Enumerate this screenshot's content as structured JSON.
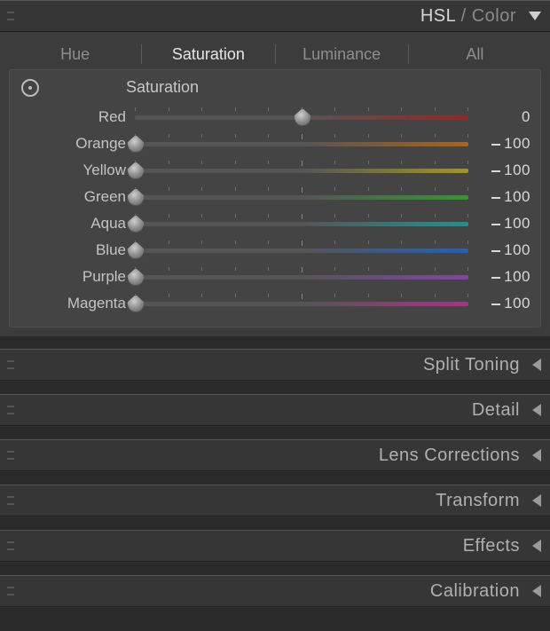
{
  "panels": {
    "hsl": {
      "title_a": "HSL",
      "title_sep": " / ",
      "title_b": "Color",
      "expanded": true,
      "tabs": [
        "Hue",
        "Saturation",
        "Luminance",
        "All"
      ],
      "active_tab": "Saturation",
      "section_title": "Saturation",
      "sliders": [
        {
          "label": "Red",
          "value": 0,
          "display": "0",
          "knob_pct": 50,
          "grad": "grad-red"
        },
        {
          "label": "Orange",
          "value": -100,
          "display": "100",
          "knob_pct": 0,
          "grad": "grad-orange",
          "neg": true
        },
        {
          "label": "Yellow",
          "value": -100,
          "display": "100",
          "knob_pct": 0,
          "grad": "grad-yellow",
          "neg": true
        },
        {
          "label": "Green",
          "value": -100,
          "display": "100",
          "knob_pct": 0,
          "grad": "grad-green",
          "neg": true
        },
        {
          "label": "Aqua",
          "value": -100,
          "display": "100",
          "knob_pct": 0,
          "grad": "grad-aqua",
          "neg": true
        },
        {
          "label": "Blue",
          "value": -100,
          "display": "100",
          "knob_pct": 0,
          "grad": "grad-blue",
          "neg": true
        },
        {
          "label": "Purple",
          "value": -100,
          "display": "100",
          "knob_pct": 0,
          "grad": "grad-purple",
          "neg": true
        },
        {
          "label": "Magenta",
          "value": -100,
          "display": "100",
          "knob_pct": 0,
          "grad": "grad-magenta",
          "neg": true
        }
      ]
    },
    "collapsed": [
      "Split Toning",
      "Detail",
      "Lens Corrections",
      "Transform",
      "Effects",
      "Calibration"
    ]
  }
}
